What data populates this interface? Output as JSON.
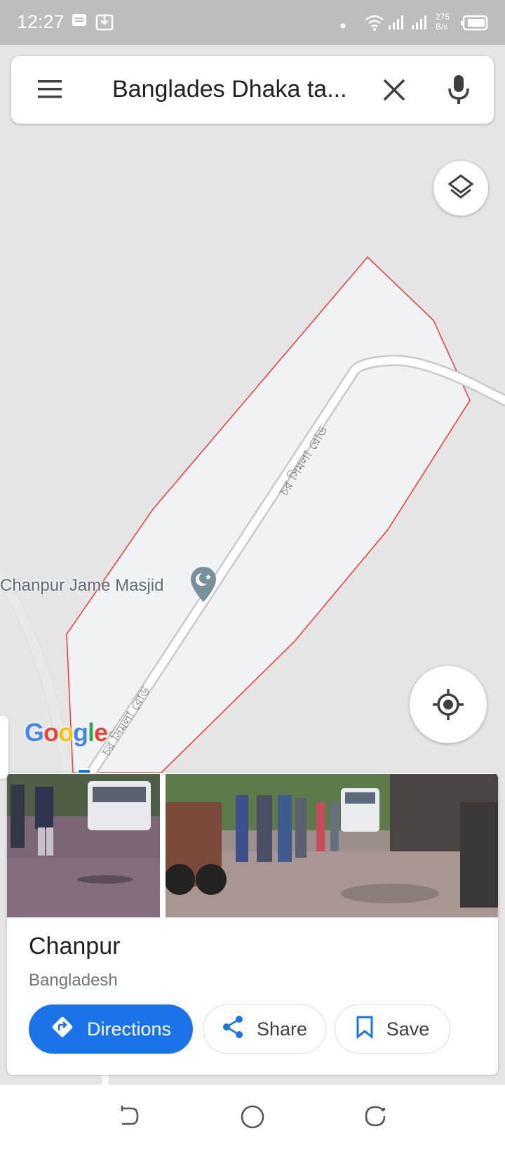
{
  "status_bar": {
    "time": "12:27",
    "net_speed_value": "275",
    "net_speed_unit": "B/s",
    "icons": [
      "message-icon",
      "download-icon",
      "dot-icon",
      "wifi-icon",
      "signal-icon",
      "signal-icon",
      "battery-icon"
    ]
  },
  "search": {
    "query": "Banglades Dhaka ta...",
    "icons": [
      "menu-icon",
      "close-icon",
      "mic-icon"
    ]
  },
  "map": {
    "poi_label": "Chanpur Jame Masjid",
    "road_label_1": "চর সিমলা রোড",
    "road_label_2": "চর সিমলা রোড",
    "boundary_color": "#e8453c",
    "area_fill_color": "#f1f2f4",
    "attribution": "Google",
    "icons": [
      "layers-icon",
      "my-location-icon",
      "mosque-pin-icon"
    ]
  },
  "place_sheet": {
    "name": "Chanpur",
    "subtitle": "Bangladesh",
    "buttons": {
      "directions": "Directions",
      "share": "Share",
      "save": "Save"
    },
    "photos_count_visible": 2
  },
  "nav_bar": {
    "icons": [
      "back-icon",
      "home-icon",
      "recents-icon"
    ]
  },
  "colors": {
    "accent": "#1a73e8",
    "status_bar_bg": "#bdbdbd"
  }
}
